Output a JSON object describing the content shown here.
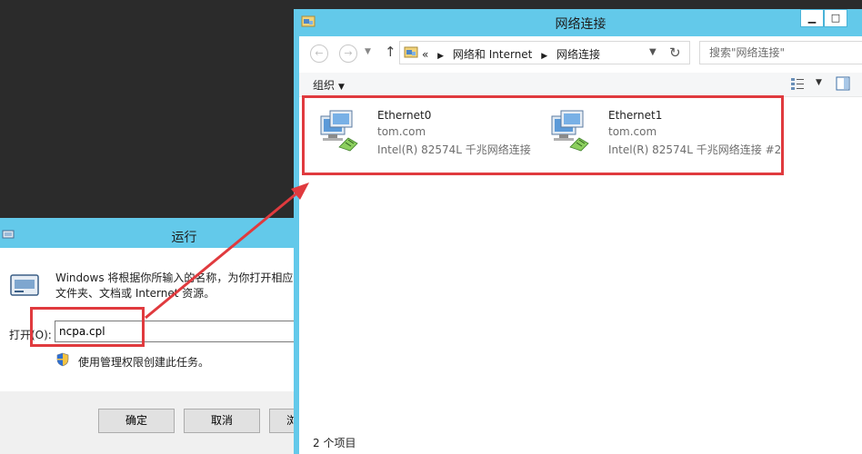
{
  "run_dialog": {
    "title": "运行",
    "description_line1": "Windows 将根据你所输入的名称，为你打开相应",
    "description_line2": "文件夹、文档或 Internet 资源。",
    "open_label": "打开(O):",
    "input_value": "ncpa.cpl",
    "admin_note": "使用管理权限创建此任务。",
    "ok_label": "确定",
    "cancel_label": "取消",
    "browse_label": "浏"
  },
  "network_window": {
    "title": "网络连接",
    "address": {
      "prefix": "«",
      "crumb1": "网络和 Internet",
      "crumb2": "网络连接"
    },
    "search_placeholder": "搜索\"网络连接\"",
    "toolbar": {
      "organize_label": "组织"
    },
    "adapters": [
      {
        "name": "Ethernet0",
        "domain": "tom.com",
        "device": "Intel(R) 82574L 千兆网络连接"
      },
      {
        "name": "Ethernet1",
        "domain": "tom.com",
        "device": "Intel(R) 82574L 千兆网络连接 #2"
      }
    ],
    "status": "2 个项目"
  },
  "colors": {
    "titlebar": "#63c9ea",
    "highlight": "#e03a3e"
  }
}
